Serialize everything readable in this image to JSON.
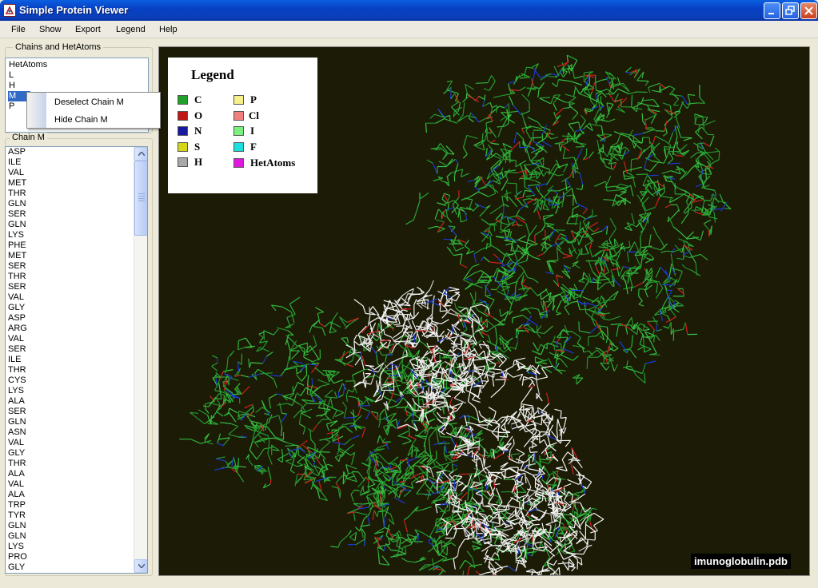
{
  "window": {
    "title": "Simple Protein Viewer"
  },
  "menu": [
    "File",
    "Show",
    "Export",
    "Legend",
    "Help"
  ],
  "chains_panel": {
    "title": "Chains and HetAtoms",
    "items": [
      "HetAtoms",
      "L",
      "H",
      "M",
      "P"
    ],
    "selected": "M"
  },
  "context_menu": {
    "items": [
      "Deselect Chain M",
      "Hide Chain M"
    ]
  },
  "chain_panel": {
    "title": "Chain M",
    "residues": [
      "ASP",
      "ILE",
      "VAL",
      "MET",
      "THR",
      "GLN",
      "SER",
      "GLN",
      "LYS",
      "PHE",
      "MET",
      "SER",
      "THR",
      "SER",
      "VAL",
      "GLY",
      "ASP",
      "ARG",
      "VAL",
      "SER",
      "ILE",
      "THR",
      "CYS",
      "LYS",
      "ALA",
      "SER",
      "GLN",
      "ASN",
      "VAL",
      "GLY",
      "THR",
      "ALA",
      "VAL",
      "ALA",
      "TRP",
      "TYR",
      "GLN",
      "GLN",
      "LYS",
      "PRO",
      "GLY"
    ]
  },
  "legend": {
    "title": "Legend",
    "items": [
      {
        "label": "C",
        "color": "#1fa02a"
      },
      {
        "label": "O",
        "color": "#c01818"
      },
      {
        "label": "N",
        "color": "#1818a0"
      },
      {
        "label": "S",
        "color": "#d6d618"
      },
      {
        "label": "H",
        "color": "#a8a8a8"
      },
      {
        "label": "P",
        "color": "#f8f08c"
      },
      {
        "label": "Cl",
        "color": "#f08080"
      },
      {
        "label": "I",
        "color": "#7cf07c"
      },
      {
        "label": "F",
        "color": "#18e0e0"
      },
      {
        "label": "HetAtoms",
        "color": "#e018e0"
      }
    ]
  },
  "viewer": {
    "file_label": "imunoglobulin.pdb",
    "background": "#1b1b06"
  }
}
